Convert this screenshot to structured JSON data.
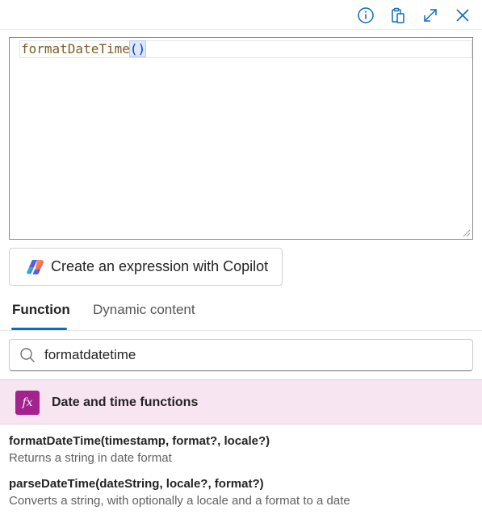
{
  "toolbar": {
    "info_icon": "info-icon",
    "paste_icon": "clipboard-paste-icon",
    "expand_icon": "expand-icon",
    "close_icon": "close-icon"
  },
  "editor": {
    "expression_name": "formatDateTime",
    "expression_parens": "()"
  },
  "copilot": {
    "label": "Create an expression with Copilot"
  },
  "tabs": [
    {
      "label": "Function",
      "selected": true
    },
    {
      "label": "Dynamic content",
      "selected": false
    }
  ],
  "search": {
    "value": "formatdatetime"
  },
  "category": {
    "icon_text": "fx",
    "label": "Date and time functions",
    "color": "#a3228e"
  },
  "functions": [
    {
      "signature": "formatDateTime(timestamp, format?, locale?)",
      "description": "Returns a string in date format"
    },
    {
      "signature": "parseDateTime(dateString, locale?, format?)",
      "description": "Converts a string, with optionally a locale and a format to a date"
    }
  ],
  "colors": {
    "accent": "#0f6cbd",
    "category_bg": "#f7e5f2"
  }
}
